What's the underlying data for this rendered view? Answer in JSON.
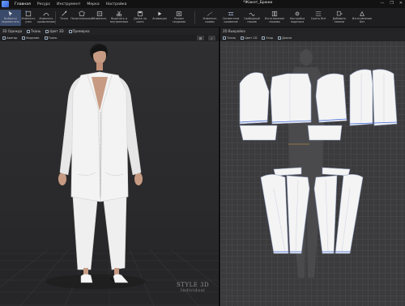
{
  "menubar": {
    "items": [
      "Главная",
      "Ресурс",
      "Инструмент",
      "Мерка",
      "Настройка"
    ],
    "active_index": 0,
    "document_title": "*Жакет_Брюки",
    "window_buttons": [
      "—",
      "❐",
      "✕"
    ]
  },
  "ribbon": {
    "tools": [
      {
        "label": "Выбрать/\nпереместить",
        "icon": "select-arrow-icon"
      },
      {
        "label": "Изменить\nузел",
        "icon": "edit-node-icon"
      },
      {
        "label": "Изменить\nкриволинию",
        "icon": "edit-curve-icon"
      },
      {
        "label": "Точка",
        "icon": "point-icon"
      },
      {
        "label": "Полигональный",
        "icon": "polygon-icon"
      },
      {
        "label": "Изменить",
        "icon": "edit-icon"
      },
      {
        "label": "Вырезать и\nвнутреннюю",
        "icon": "cut-icon"
      },
      {
        "label": "Диска ла\nшить",
        "icon": "disk-icon"
      },
      {
        "label": "Анимация",
        "icon": "animation-icon"
      },
      {
        "label": "Режим\nсоздания",
        "icon": "create-mode-icon"
      },
      {
        "label": "Изменить\nсшивы",
        "icon": "edit-seam-icon"
      },
      {
        "label": "Сегментное\nсшивание",
        "icon": "segment-sew-icon"
      },
      {
        "label": "Свободный\nпошив",
        "icon": "free-sew-icon"
      },
      {
        "label": "Изготовление\nпошива",
        "icon": "make-sew-icon"
      },
      {
        "label": "Настройка\nподплоса",
        "icon": "settings-icon"
      },
      {
        "label": "Сшить Всё",
        "icon": "sew-all-icon"
      },
      {
        "label": "Добавить\nпанели",
        "icon": "add-panel-icon"
      },
      {
        "label": "Изготовление\nБез",
        "icon": "make-icon"
      }
    ]
  },
  "left_panel": {
    "tabs": [
      "3D Одежда",
      "Ткань",
      "Цвет 3D",
      "Примерка"
    ],
    "toolbar": [
      "Аватар",
      "Изделие",
      "Ткань"
    ],
    "right_icons": [
      "⚙",
      "✓"
    ]
  },
  "right_panel": {
    "tabs": [
      "2D Выкройка"
    ],
    "toolbar": [
      "Ткань",
      "Цвет 2D",
      "Узор",
      "Длина"
    ]
  },
  "watermark": {
    "brand": "STYLE 3D",
    "edition": "Individual"
  },
  "colors": {
    "accent": "#3a64d8",
    "selected": "#3a4a6b",
    "pattern_fill": "#f4f4f4",
    "grid": "#444447"
  }
}
